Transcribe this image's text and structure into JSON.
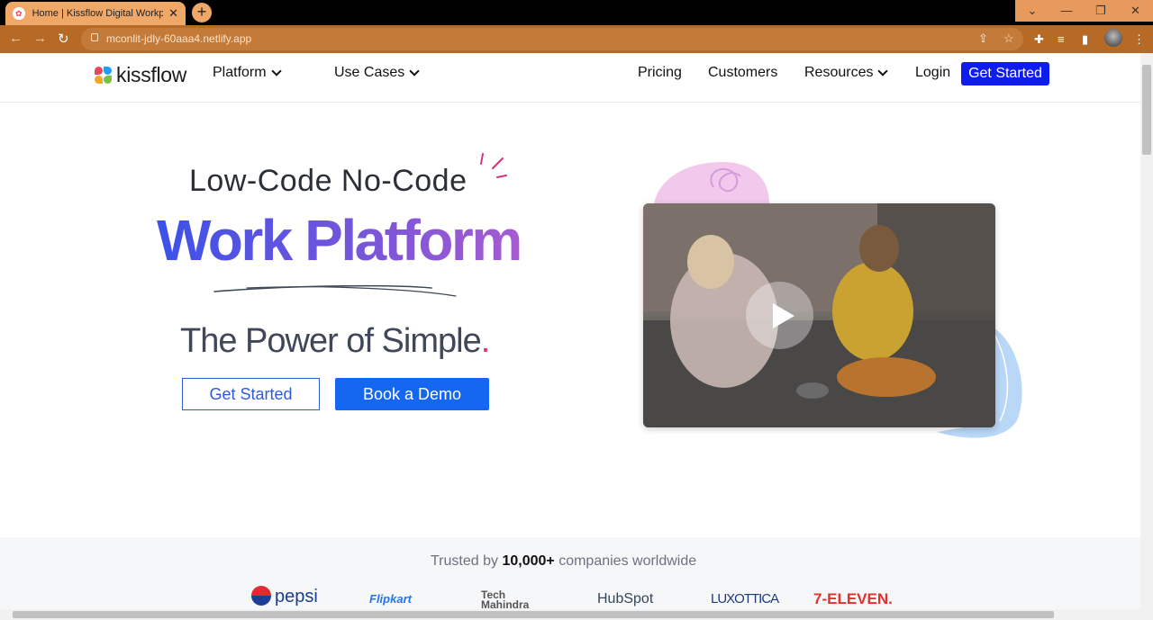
{
  "browser": {
    "tab_title": "Home | Kissflow Digital Workplac",
    "new_tab": "+",
    "url": "mconlit-jdly-60aaa4.netlify.app"
  },
  "header": {
    "brand": "kissflow",
    "nav": {
      "platform": "Platform",
      "use_cases": "Use Cases",
      "pricing": "Pricing",
      "customers": "Customers",
      "resources": "Resources",
      "login": "Login",
      "get_started": "Get Started"
    }
  },
  "hero": {
    "line1": "Low-Code No-Code",
    "line2": "Work Platform",
    "line3": "The Power of Simple",
    "line3_dot": ".",
    "cta_primary": "Get Started",
    "cta_secondary": "Book a Demo"
  },
  "trusted": {
    "prefix": "Trusted by",
    "count": "10,000+",
    "suffix": "companies worldwide",
    "brands": [
      "pepsi",
      "Flipkart",
      "Tech Mahindra",
      "HubSpot",
      "LUXOTTICA",
      "7-ELEVEN."
    ]
  },
  "colors": {
    "accent_blue": "#0f1cf0",
    "button_blue": "#1566f0",
    "gradient_start": "#3b52e8",
    "gradient_end": "#a65bd2",
    "dot_pink": "#d6317a",
    "browser_orange": "#b76a26"
  }
}
